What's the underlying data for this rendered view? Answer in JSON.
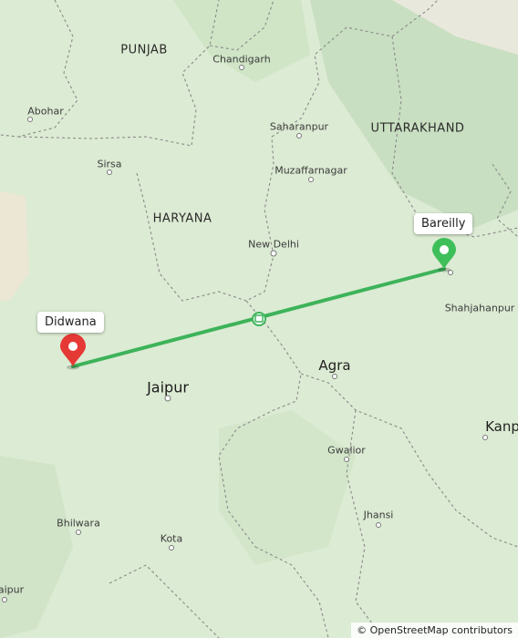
{
  "map": {
    "states": [
      {
        "id": "punjab",
        "label": "PUNJAB"
      },
      {
        "id": "haryana",
        "label": "HARYANA"
      },
      {
        "id": "uttarakhand",
        "label": "UTTARAKHAND"
      }
    ],
    "cities": {
      "chandigarh": "Chandigarh",
      "abohar": "Abohar",
      "saharanpur": "Saharanpur",
      "sirsa": "Sirsa",
      "muzaffarnagar": "Muzaffarnagar",
      "new_delhi": "New Delhi",
      "shahjahanpur": "Shahjahanpur",
      "agra": "Agra",
      "jaipur": "Jaipur",
      "kanpur_partial": "Kanp",
      "gwalior": "Gwalior",
      "jhansi": "Jhansi",
      "bhilwara": "Bhilwara",
      "kota": "Kota",
      "udaipur_partial": "aipur"
    },
    "route": {
      "origin": "Didwana",
      "destination": "Bareilly",
      "color": "#3db35a",
      "origin_marker_color": "#e53935",
      "destination_marker_color": "#3fbf5a"
    },
    "attribution": "© OpenStreetMap contributors",
    "colors": {
      "land": "#dcebd3",
      "forest": "#cde3c3",
      "desert": "#ece7d5",
      "hills": "#c5dcc0",
      "border": "#8a8a8a"
    }
  }
}
